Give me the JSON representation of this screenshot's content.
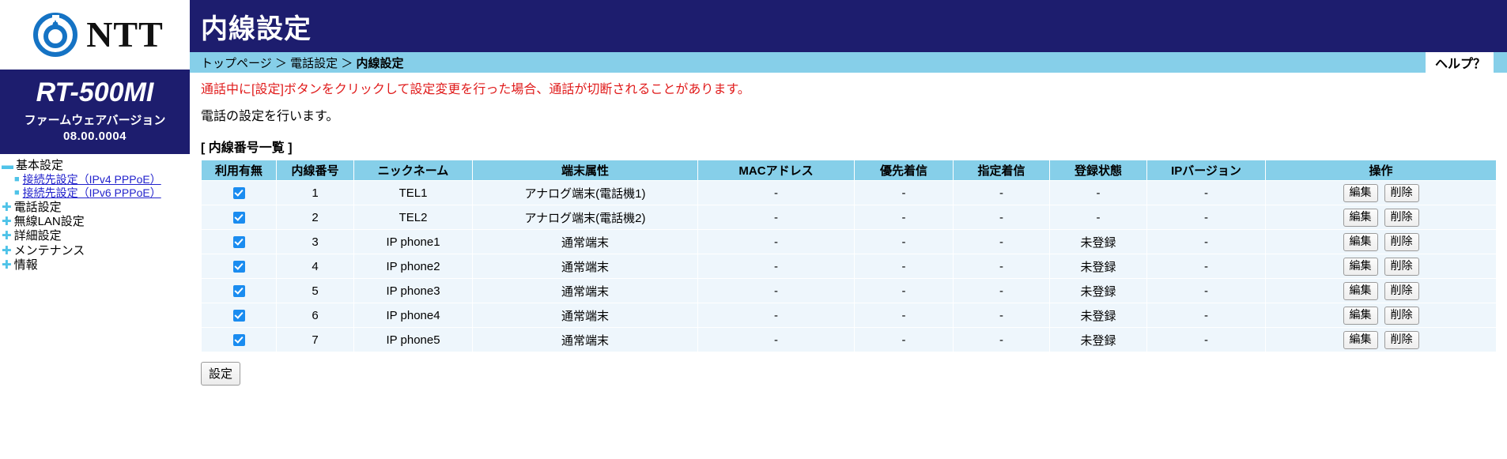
{
  "brand": {
    "logo_text": "NTT",
    "logo_icon": "ntt-swirl-logo",
    "model": "RT-500MI",
    "firmware_label": "ファームウェアバージョン",
    "firmware_version": "08.00.0004",
    "navy": "#1d1d6e",
    "light_blue": "#86cfe9",
    "accent_cyan": "#4fc3e8",
    "link_blue": "#2222cc",
    "warn_red": "#e01b1b"
  },
  "sidebar": {
    "items": [
      {
        "label": "基本設定",
        "bullet": "▬",
        "children": [
          {
            "label": "接続先設定（IPv4 PPPoE）"
          },
          {
            "label": "接続先設定（IPv6 PPPoE）"
          }
        ]
      },
      {
        "label": "電話設定",
        "bullet": "✚",
        "children": []
      },
      {
        "label": "無線LAN設定",
        "bullet": "✚",
        "children": []
      },
      {
        "label": "詳細設定",
        "bullet": "✚",
        "children": []
      },
      {
        "label": "メンテナンス",
        "bullet": "✚",
        "children": []
      },
      {
        "label": "情報",
        "bullet": "✚",
        "children": []
      }
    ]
  },
  "header": {
    "title": "内線設定",
    "breadcrumb": [
      "トップページ",
      "電話設定",
      "内線設定"
    ],
    "breadcrumb_separator": "＞",
    "help_label": "ヘルプ？"
  },
  "content": {
    "warning": "通話中に[設定]ボタンをクリックして設定変更を行った場合、通話が切断されることがあります。",
    "description": "電話の設定を行います。",
    "section_label": "[ 内線番号一覧 ]",
    "submit_label": "設定"
  },
  "table": {
    "columns": [
      "利用有無",
      "内線番号",
      "ニックネーム",
      "端末属性",
      "MACアドレス",
      "優先着信",
      "指定着信",
      "登録状態",
      "IPバージョン",
      "操作"
    ],
    "edit_label": "編集",
    "delete_label": "削除",
    "rows": [
      {
        "enabled": true,
        "number": "1",
        "nickname": "TEL1",
        "attribute": "アナログ端末(電話機1)",
        "mac": "-",
        "priority": "-",
        "designated": "-",
        "registration": "-",
        "ipversion": "-"
      },
      {
        "enabled": true,
        "number": "2",
        "nickname": "TEL2",
        "attribute": "アナログ端末(電話機2)",
        "mac": "-",
        "priority": "-",
        "designated": "-",
        "registration": "-",
        "ipversion": "-"
      },
      {
        "enabled": true,
        "number": "3",
        "nickname": "IP phone1",
        "attribute": "通常端末",
        "mac": "-",
        "priority": "-",
        "designated": "-",
        "registration": "未登録",
        "ipversion": "-"
      },
      {
        "enabled": true,
        "number": "4",
        "nickname": "IP phone2",
        "attribute": "通常端末",
        "mac": "-",
        "priority": "-",
        "designated": "-",
        "registration": "未登録",
        "ipversion": "-"
      },
      {
        "enabled": true,
        "number": "5",
        "nickname": "IP phone3",
        "attribute": "通常端末",
        "mac": "-",
        "priority": "-",
        "designated": "-",
        "registration": "未登録",
        "ipversion": "-"
      },
      {
        "enabled": true,
        "number": "6",
        "nickname": "IP phone4",
        "attribute": "通常端末",
        "mac": "-",
        "priority": "-",
        "designated": "-",
        "registration": "未登録",
        "ipversion": "-"
      },
      {
        "enabled": true,
        "number": "7",
        "nickname": "IP phone5",
        "attribute": "通常端末",
        "mac": "-",
        "priority": "-",
        "designated": "-",
        "registration": "未登録",
        "ipversion": "-"
      }
    ]
  }
}
